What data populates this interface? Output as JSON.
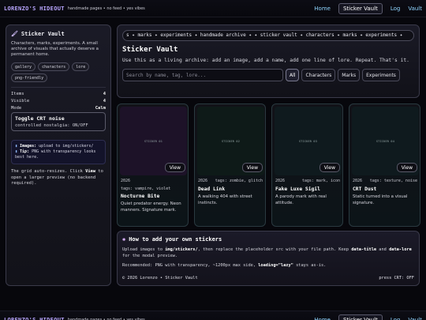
{
  "nav": {
    "brand": "LORENZO'S HIDEOUT",
    "tagline": "handmade pages • no feed • yes vibes",
    "links": [
      "Home",
      "Sticker Vault",
      "Log",
      "Vault"
    ],
    "active_index": 1
  },
  "sidebar": {
    "title": "Sticker Vault",
    "title_icon": "brush-icon",
    "description": "Characters, marks, experiments. A small archive of visuals that actually deserve a permanent home.",
    "chips": [
      "gallery",
      "characters",
      "lore",
      "png-friendly"
    ],
    "stats": [
      {
        "label": "Items",
        "value": "4"
      },
      {
        "label": "Visible",
        "value": "4"
      },
      {
        "label": "Mode",
        "value": "Calm"
      }
    ],
    "toggle": {
      "title": "Toggle CRT noise",
      "subtitle": "controlled nostalgia: ON/OFF"
    },
    "tips": [
      {
        "key": "Images:",
        "text": "upload to img/stickers/"
      },
      {
        "key": "Tip:",
        "text": "PNG with transparency looks best here."
      }
    ],
    "note_parts": [
      "The grid auto-resizes. Click ",
      "View",
      " to open a larger preview (no backend required)."
    ]
  },
  "header": {
    "marquee": "s ✦ marks ✦ experiments ✦ handmade archive ✦  ✦ sticker vault ✦ characters ✦ marks ✦ experiments ✦",
    "title": "Sticker Vault",
    "description": "Use this as a living archive: add an image, add a name, add one line of lore. Repeat. That's it.",
    "search_placeholder": "Search by name, tag, lore...",
    "filters": [
      "All",
      "Characters",
      "Marks",
      "Experiments"
    ],
    "active_filter": 0
  },
  "cards": [
    {
      "year": "2026",
      "tags": "tags: vampire, violet",
      "name": "Nocturne Bite",
      "lore": "Quiet predator energy. Neon manners. Signature mark.",
      "thumb_label": "STICKER 01",
      "thumb_color": "#1d1228",
      "view": "View"
    },
    {
      "year": "2026",
      "tags": "tags: zombie, glitch",
      "name": "Dead Link",
      "lore": "A walking 404 with street instincts.",
      "thumb_label": "STICKER 02",
      "thumb_color": "#0e1a18",
      "view": "View"
    },
    {
      "year": "2026",
      "tags": "tags: mark, icon",
      "name": "Fake Luxe Sigil",
      "lore": "A parody mark with real attitude.",
      "thumb_label": "STICKER 03",
      "thumb_color": "#0f1a1e",
      "view": "View"
    },
    {
      "year": "2026",
      "tags": "tags: texture, noise",
      "name": "CRT Dust",
      "lore": "Static turned into a visual signature.",
      "thumb_label": "STICKER 04",
      "thumb_color": "#0f1a1e",
      "view": "View"
    }
  ],
  "howto": {
    "title": "How to add your own stickers",
    "title_icon": "brain-icon",
    "p1_parts": [
      "Upload images to ",
      "img/stickers/",
      ", then replace the placeholder src with your file path. Keep ",
      "data-title",
      " and ",
      "data-lore",
      " for the modal preview."
    ],
    "p2_parts": [
      "Recommended: PNG with transparency, ~1200px max side, ",
      "loading=\"lazy\"",
      " stays as-is."
    ],
    "footer_left": "© 2026 Lorenzo • Sticker Vault",
    "footer_right": "press CRT: OFF"
  }
}
